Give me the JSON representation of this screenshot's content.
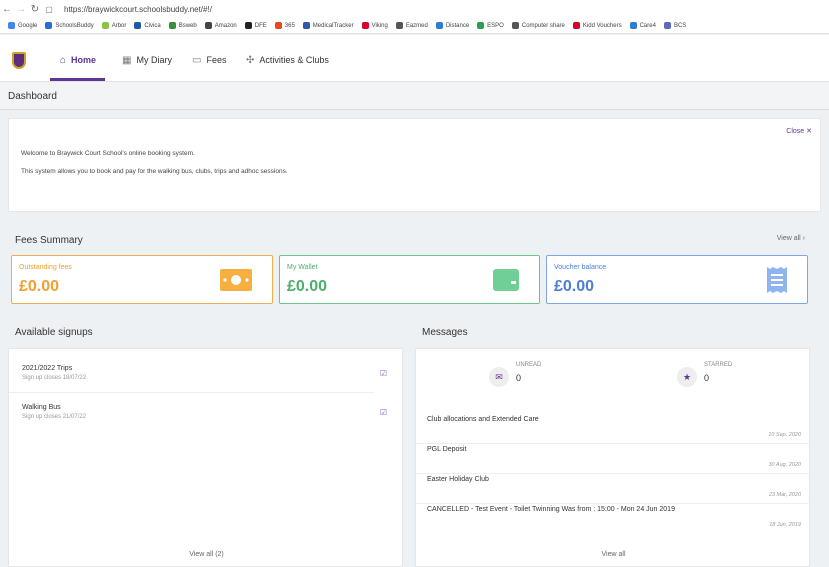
{
  "browser": {
    "url": "https://braywickcourt.schoolsbuddy.net/#!/",
    "bookmarks": [
      {
        "label": "Google",
        "color": "#4285f4"
      },
      {
        "label": "SchoolsBuddy",
        "color": "#2a6bd6"
      },
      {
        "label": "Arbor",
        "color": "#8bc34a"
      },
      {
        "label": "Civica",
        "color": "#1f5aa6"
      },
      {
        "label": "Bsweb",
        "color": "#3b8f3b"
      },
      {
        "label": "Amazon",
        "color": "#444444"
      },
      {
        "label": "DFE",
        "color": "#222222"
      },
      {
        "label": "365",
        "color": "#e8481c"
      },
      {
        "label": "MedicalTracker",
        "color": "#2b5aa8"
      },
      {
        "label": "Viking",
        "color": "#d6002a"
      },
      {
        "label": "Eazmed",
        "color": "#555555"
      },
      {
        "label": "Distance",
        "color": "#2a7fd4"
      },
      {
        "label": "ESPO",
        "color": "#2e9e4f"
      },
      {
        "label": "Computer share",
        "color": "#555555"
      },
      {
        "label": "Kidd Vouchers",
        "color": "#d6002a"
      },
      {
        "label": "Care4",
        "color": "#2a7fd4"
      },
      {
        "label": "BCS",
        "color": "#5c6bc0"
      }
    ]
  },
  "nav": {
    "items": [
      {
        "label": "Home",
        "icon": "home-icon"
      },
      {
        "label": "My Diary",
        "icon": "calendar-icon"
      },
      {
        "label": "Fees",
        "icon": "card-icon"
      },
      {
        "label": "Activities & Clubs",
        "icon": "activities-icon"
      }
    ]
  },
  "dashboard": {
    "title": "Dashboard"
  },
  "welcome": {
    "close_label": "Close ✕",
    "line1": "Welcome to Braywick Court School's online booking system.",
    "line2": "This system allows you to book and pay for the walking bus, clubs, trips and adhoc sessions."
  },
  "fees": {
    "title": "Fees Summary",
    "view_all": "View all ›",
    "cards": [
      {
        "label": "Outstanding fees",
        "amount": "£0.00",
        "icon": "cash-icon",
        "color": "#f0a02e"
      },
      {
        "label": "My Wallet",
        "amount": "£0.00",
        "icon": "wallet-icon",
        "color": "#4caf6e"
      },
      {
        "label": "Voucher balance",
        "amount": "£0.00",
        "icon": "receipt-icon",
        "color": "#4a7fd4"
      }
    ]
  },
  "signups": {
    "title": "Available signups",
    "items": [
      {
        "name": "2021/2022 Trips",
        "closes": "Sign up closes 18/07/22"
      },
      {
        "name": "Walking Bus",
        "closes": "Sign up closes 21/07/22"
      }
    ],
    "view_all": "View all (2)"
  },
  "messages": {
    "title": "Messages",
    "unread_label": "UNREAD",
    "unread_count": "0",
    "starred_label": "STARRED",
    "starred_count": "0",
    "items": [
      {
        "title": "Club allocations and Extended Care",
        "date": "10 Sep, 2020"
      },
      {
        "title": "PGL Deposit",
        "date": "30 Aug, 2020"
      },
      {
        "title": "Easter Holiday Club",
        "date": "23 Mar, 2020"
      },
      {
        "title": "CANCELLED - Test Event - Toilet Twinning Was from : 15:00 - Mon 24 Jun 2019",
        "date": "18 Jun, 2019"
      }
    ],
    "view_all": "View all"
  },
  "colors": {
    "accent": "#5c3596"
  }
}
